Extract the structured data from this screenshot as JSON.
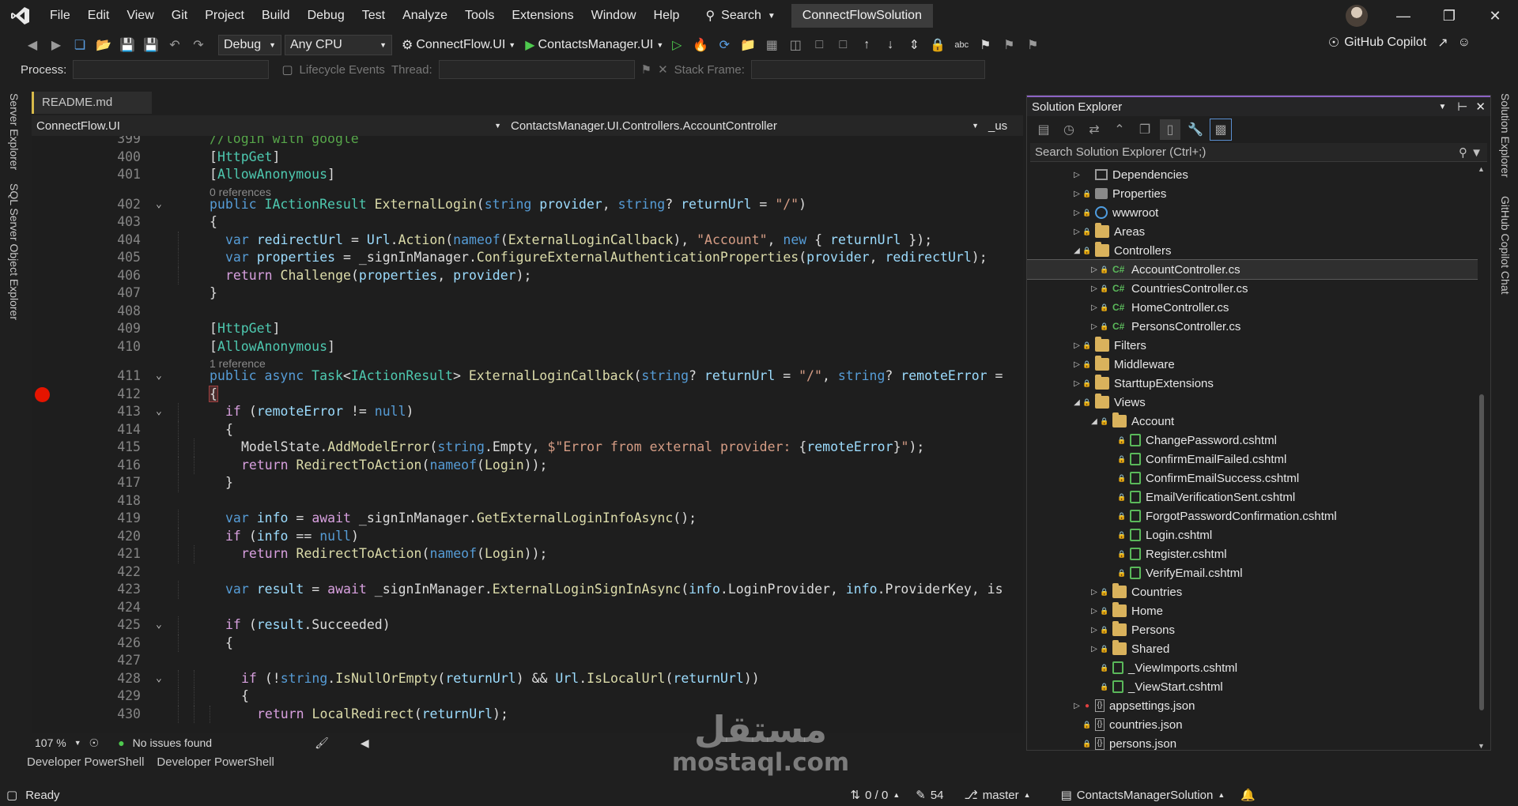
{
  "menu": [
    "File",
    "Edit",
    "View",
    "Git",
    "Project",
    "Build",
    "Debug",
    "Test",
    "Analyze",
    "Tools",
    "Extensions",
    "Window",
    "Help"
  ],
  "search_label": "Search",
  "solution_title": "ConnectFlowSolution",
  "toolbar": {
    "config": "Debug",
    "platform": "Any CPU",
    "startup_project": "ConnectFlow.UI",
    "run_target": "ContactsManager.UI",
    "copilot": "GitHub Copilot"
  },
  "debugbar": {
    "process_label": "Process:",
    "lifecycle_label": "Lifecycle Events",
    "thread_label": "Thread:",
    "stack_label": "Stack Frame:"
  },
  "left_tabs": [
    "Server Explorer",
    "SQL Server Object Explorer"
  ],
  "right_tabs": [
    "Solution Explorer",
    "GitHub Copilot Chat"
  ],
  "doc_tab": "README.md",
  "navbar": {
    "project": "ConnectFlow.UI",
    "class": "ContactsManager.UI.Controllers.AccountController",
    "member": "_us"
  },
  "code_lines": [
    {
      "no": "399",
      "indent": 1,
      "tokens": [
        [
          "cm",
          "//login with google"
        ]
      ]
    },
    {
      "no": "400",
      "indent": 1,
      "tokens": [
        [
          "pl",
          "["
        ],
        [
          "ty",
          "HttpGet"
        ],
        [
          "pl",
          "]"
        ]
      ]
    },
    {
      "no": "401",
      "indent": 1,
      "tokens": [
        [
          "pl",
          "["
        ],
        [
          "ty",
          "AllowAnonymous"
        ],
        [
          "pl",
          "]"
        ]
      ],
      "ref": "0 references"
    },
    {
      "no": "402",
      "indent": 1,
      "fold": true,
      "tokens": [
        [
          "kw",
          "public "
        ],
        [
          "ty",
          "IActionResult "
        ],
        [
          "fn",
          "ExternalLogin"
        ],
        [
          "pl",
          "("
        ],
        [
          "kw",
          "string "
        ],
        [
          "var",
          "provider"
        ],
        [
          "pl",
          ", "
        ],
        [
          "kw",
          "string"
        ],
        [
          "pl",
          "? "
        ],
        [
          "var",
          "returnUrl"
        ],
        [
          "pl",
          " = "
        ],
        [
          "str",
          "\"/\""
        ],
        [
          "pl",
          ")"
        ]
      ]
    },
    {
      "no": "403",
      "indent": 1,
      "tokens": [
        [
          "pl",
          "{"
        ]
      ]
    },
    {
      "no": "404",
      "indent": 2,
      "tokens": [
        [
          "kw",
          "var "
        ],
        [
          "var",
          "redirectUrl"
        ],
        [
          "pl",
          " = "
        ],
        [
          "var",
          "Url"
        ],
        [
          "pl",
          "."
        ],
        [
          "fn",
          "Action"
        ],
        [
          "pl",
          "("
        ],
        [
          "kw",
          "nameof"
        ],
        [
          "pl",
          "("
        ],
        [
          "fn",
          "ExternalLoginCallback"
        ],
        [
          "pl",
          "), "
        ],
        [
          "str",
          "\"Account\""
        ],
        [
          "pl",
          ", "
        ],
        [
          "kw",
          "new"
        ],
        [
          "pl",
          " { "
        ],
        [
          "var",
          "returnUrl"
        ],
        [
          "pl",
          " });"
        ]
      ]
    },
    {
      "no": "405",
      "indent": 2,
      "tokens": [
        [
          "kw",
          "var "
        ],
        [
          "var",
          "properties"
        ],
        [
          "pl",
          " = _signInManager."
        ],
        [
          "fn",
          "ConfigureExternalAuthenticationProperties"
        ],
        [
          "pl",
          "("
        ],
        [
          "var",
          "provider"
        ],
        [
          "pl",
          ", "
        ],
        [
          "var",
          "redirectUrl"
        ],
        [
          "pl",
          ");"
        ]
      ]
    },
    {
      "no": "406",
      "indent": 2,
      "tokens": [
        [
          "ctl",
          "return "
        ],
        [
          "fn",
          "Challenge"
        ],
        [
          "pl",
          "("
        ],
        [
          "var",
          "properties"
        ],
        [
          "pl",
          ", "
        ],
        [
          "var",
          "provider"
        ],
        [
          "pl",
          ");"
        ]
      ]
    },
    {
      "no": "407",
      "indent": 1,
      "tokens": [
        [
          "pl",
          "}"
        ]
      ]
    },
    {
      "no": "408",
      "indent": 0,
      "tokens": []
    },
    {
      "no": "409",
      "indent": 1,
      "tokens": [
        [
          "pl",
          "["
        ],
        [
          "ty",
          "HttpGet"
        ],
        [
          "pl",
          "]"
        ]
      ]
    },
    {
      "no": "410",
      "indent": 1,
      "tokens": [
        [
          "pl",
          "["
        ],
        [
          "ty",
          "AllowAnonymous"
        ],
        [
          "pl",
          "]"
        ]
      ],
      "ref": "1 reference"
    },
    {
      "no": "411",
      "indent": 1,
      "fold": true,
      "tokens": [
        [
          "kw",
          "public "
        ],
        [
          "kw",
          "async "
        ],
        [
          "ty",
          "Task"
        ],
        [
          "pl",
          "<"
        ],
        [
          "ty",
          "IActionResult"
        ],
        [
          "pl",
          "> "
        ],
        [
          "fn",
          "ExternalLoginCallback"
        ],
        [
          "pl",
          "("
        ],
        [
          "kw",
          "string"
        ],
        [
          "pl",
          "? "
        ],
        [
          "var",
          "returnUrl"
        ],
        [
          "pl",
          " = "
        ],
        [
          "str",
          "\"/\""
        ],
        [
          "pl",
          ", "
        ],
        [
          "kw",
          "string"
        ],
        [
          "pl",
          "? "
        ],
        [
          "var",
          "remoteError"
        ],
        [
          "pl",
          " ="
        ]
      ]
    },
    {
      "no": "412",
      "indent": 1,
      "breakpoint": true,
      "tokens": [
        [
          "br",
          "{"
        ]
      ]
    },
    {
      "no": "413",
      "indent": 2,
      "fold": true,
      "tokens": [
        [
          "ctl",
          "if "
        ],
        [
          "pl",
          "("
        ],
        [
          "var",
          "remoteError"
        ],
        [
          "pl",
          " != "
        ],
        [
          "kw",
          "null"
        ],
        [
          "pl",
          ")"
        ]
      ]
    },
    {
      "no": "414",
      "indent": 2,
      "tokens": [
        [
          "pl",
          "{"
        ]
      ]
    },
    {
      "no": "415",
      "indent": 3,
      "tokens": [
        [
          "pl",
          "ModelState."
        ],
        [
          "fn",
          "AddModelError"
        ],
        [
          "pl",
          "("
        ],
        [
          "kw",
          "string"
        ],
        [
          "pl",
          ".Empty, "
        ],
        [
          "str",
          "$\"Error from external provider: "
        ],
        [
          "pl",
          "{"
        ],
        [
          "var",
          "remoteError"
        ],
        [
          "pl",
          "}"
        ],
        [
          "str",
          "\""
        ],
        [
          "pl",
          ");"
        ]
      ]
    },
    {
      "no": "416",
      "indent": 3,
      "tokens": [
        [
          "ctl",
          "return "
        ],
        [
          "fn",
          "RedirectToAction"
        ],
        [
          "pl",
          "("
        ],
        [
          "kw",
          "nameof"
        ],
        [
          "pl",
          "("
        ],
        [
          "fn",
          "Login"
        ],
        [
          "pl",
          "));"
        ]
      ]
    },
    {
      "no": "417",
      "indent": 2,
      "tokens": [
        [
          "pl",
          "}"
        ]
      ]
    },
    {
      "no": "418",
      "indent": 0,
      "tokens": []
    },
    {
      "no": "419",
      "indent": 2,
      "tokens": [
        [
          "kw",
          "var "
        ],
        [
          "var",
          "info"
        ],
        [
          "pl",
          " = "
        ],
        [
          "ctl",
          "await "
        ],
        [
          "pl",
          "_signInManager."
        ],
        [
          "fn",
          "GetExternalLoginInfoAsync"
        ],
        [
          "pl",
          "();"
        ]
      ]
    },
    {
      "no": "420",
      "indent": 2,
      "tokens": [
        [
          "ctl",
          "if "
        ],
        [
          "pl",
          "("
        ],
        [
          "var",
          "info"
        ],
        [
          "pl",
          " == "
        ],
        [
          "kw",
          "null"
        ],
        [
          "pl",
          ")"
        ]
      ]
    },
    {
      "no": "421",
      "indent": 3,
      "tokens": [
        [
          "ctl",
          "return "
        ],
        [
          "fn",
          "RedirectToAction"
        ],
        [
          "pl",
          "("
        ],
        [
          "kw",
          "nameof"
        ],
        [
          "pl",
          "("
        ],
        [
          "fn",
          "Login"
        ],
        [
          "pl",
          "));"
        ]
      ]
    },
    {
      "no": "422",
      "indent": 0,
      "tokens": []
    },
    {
      "no": "423",
      "indent": 2,
      "tokens": [
        [
          "kw",
          "var "
        ],
        [
          "var",
          "result"
        ],
        [
          "pl",
          " = "
        ],
        [
          "ctl",
          "await "
        ],
        [
          "pl",
          "_signInManager."
        ],
        [
          "fn",
          "ExternalLoginSignInAsync"
        ],
        [
          "pl",
          "("
        ],
        [
          "var",
          "info"
        ],
        [
          "pl",
          ".LoginProvider, "
        ],
        [
          "var",
          "info"
        ],
        [
          "pl",
          ".ProviderKey, is"
        ]
      ]
    },
    {
      "no": "424",
      "indent": 0,
      "tokens": []
    },
    {
      "no": "425",
      "indent": 2,
      "fold": true,
      "tokens": [
        [
          "ctl",
          "if "
        ],
        [
          "pl",
          "("
        ],
        [
          "var",
          "result"
        ],
        [
          "pl",
          ".Succeeded)"
        ]
      ]
    },
    {
      "no": "426",
      "indent": 2,
      "tokens": [
        [
          "pl",
          "{"
        ]
      ]
    },
    {
      "no": "427",
      "indent": 0,
      "tokens": []
    },
    {
      "no": "428",
      "indent": 3,
      "fold": true,
      "tokens": [
        [
          "ctl",
          "if "
        ],
        [
          "pl",
          "(!"
        ],
        [
          "kw",
          "string"
        ],
        [
          "pl",
          "."
        ],
        [
          "fn",
          "IsNullOrEmpty"
        ],
        [
          "pl",
          "("
        ],
        [
          "var",
          "returnUrl"
        ],
        [
          "pl",
          ") && "
        ],
        [
          "var",
          "Url"
        ],
        [
          "pl",
          "."
        ],
        [
          "fn",
          "IsLocalUrl"
        ],
        [
          "pl",
          "("
        ],
        [
          "var",
          "returnUrl"
        ],
        [
          "pl",
          "))"
        ]
      ]
    },
    {
      "no": "429",
      "indent": 3,
      "tokens": [
        [
          "pl",
          "{"
        ]
      ]
    },
    {
      "no": "430",
      "indent": 4,
      "tokens": [
        [
          "ctl",
          "return "
        ],
        [
          "fn",
          "LocalRedirect"
        ],
        [
          "pl",
          "("
        ],
        [
          "var",
          "returnUrl"
        ],
        [
          "pl",
          ");"
        ]
      ]
    }
  ],
  "editor_status": {
    "zoom": "107 %",
    "issues": "No issues found"
  },
  "bottom_tabs": [
    "Developer PowerShell",
    "Developer PowerShell"
  ],
  "statusbar": {
    "ready": "Ready",
    "changes": "0 / 0",
    "edits": "54",
    "branch": "master",
    "repo": "ContactsManagerSolution"
  },
  "solution_explorer": {
    "title": "Solution Explorer",
    "search_placeholder": "Search Solution Explorer (Ctrl+;)",
    "items": [
      {
        "label": "Dependencies",
        "level": 0,
        "arrow": "right",
        "icon": "deps",
        "lock": false
      },
      {
        "label": "Properties",
        "level": 0,
        "arrow": "right",
        "icon": "props",
        "lock": true
      },
      {
        "label": "wwwroot",
        "level": 0,
        "arrow": "right",
        "icon": "globe",
        "lock": true
      },
      {
        "label": "Areas",
        "level": 0,
        "arrow": "right",
        "icon": "folder",
        "lock": true
      },
      {
        "label": "Controllers",
        "level": 0,
        "arrow": "down",
        "icon": "folder",
        "lock": true
      },
      {
        "label": "AccountController.cs",
        "level": 1,
        "arrow": "right",
        "icon": "cs",
        "lock": true,
        "selected": true
      },
      {
        "label": "CountriesController.cs",
        "level": 1,
        "arrow": "right",
        "icon": "cs",
        "lock": true
      },
      {
        "label": "HomeController.cs",
        "level": 1,
        "arrow": "right",
        "icon": "cs",
        "lock": true
      },
      {
        "label": "PersonsController.cs",
        "level": 1,
        "arrow": "right",
        "icon": "cs",
        "lock": true
      },
      {
        "label": "Filters",
        "level": 0,
        "arrow": "right",
        "icon": "folder",
        "lock": true
      },
      {
        "label": "Middleware",
        "level": 0,
        "arrow": "right",
        "icon": "folder",
        "lock": true
      },
      {
        "label": "StarttupExtensions",
        "level": 0,
        "arrow": "right",
        "icon": "folder",
        "lock": true
      },
      {
        "label": "Views",
        "level": 0,
        "arrow": "down",
        "icon": "folder",
        "lock": true
      },
      {
        "label": "Account",
        "level": 1,
        "arrow": "down",
        "icon": "folder",
        "lock": true
      },
      {
        "label": "ChangePassword.cshtml",
        "level": 2,
        "arrow": "none",
        "icon": "cshtml",
        "lock": true
      },
      {
        "label": "ConfirmEmailFailed.cshtml",
        "level": 2,
        "arrow": "none",
        "icon": "cshtml",
        "lock": true
      },
      {
        "label": "ConfirmEmailSuccess.cshtml",
        "level": 2,
        "arrow": "none",
        "icon": "cshtml",
        "lock": true
      },
      {
        "label": "EmailVerificationSent.cshtml",
        "level": 2,
        "arrow": "none",
        "icon": "cshtml",
        "lock": true
      },
      {
        "label": "ForgotPasswordConfirmation.cshtml",
        "level": 2,
        "arrow": "none",
        "icon": "cshtml",
        "lock": true
      },
      {
        "label": "Login.cshtml",
        "level": 2,
        "arrow": "none",
        "icon": "cshtml",
        "lock": true
      },
      {
        "label": "Register.cshtml",
        "level": 2,
        "arrow": "none",
        "icon": "cshtml",
        "lock": true
      },
      {
        "label": "VerifyEmail.cshtml",
        "level": 2,
        "arrow": "none",
        "icon": "cshtml",
        "lock": true
      },
      {
        "label": "Countries",
        "level": 1,
        "arrow": "right",
        "icon": "folder",
        "lock": true
      },
      {
        "label": "Home",
        "level": 1,
        "arrow": "right",
        "icon": "folder",
        "lock": true
      },
      {
        "label": "Persons",
        "level": 1,
        "arrow": "right",
        "icon": "folder",
        "lock": true
      },
      {
        "label": "Shared",
        "level": 1,
        "arrow": "right",
        "icon": "folder",
        "lock": true
      },
      {
        "label": "_ViewImports.cshtml",
        "level": 1,
        "arrow": "none",
        "icon": "cshtml",
        "lock": true
      },
      {
        "label": "_ViewStart.cshtml",
        "level": 1,
        "arrow": "none",
        "icon": "cshtml",
        "lock": true
      },
      {
        "label": "appsettings.json",
        "level": 0,
        "arrow": "right",
        "icon": "json",
        "lock": false,
        "error": true
      },
      {
        "label": "countries.json",
        "level": 0,
        "arrow": "none",
        "icon": "json",
        "lock": true
      },
      {
        "label": "persons.json",
        "level": 0,
        "arrow": "none",
        "icon": "json",
        "lock": true
      }
    ]
  },
  "watermark": {
    "arabic": "مستقل",
    "latin": "mostaql.com"
  }
}
